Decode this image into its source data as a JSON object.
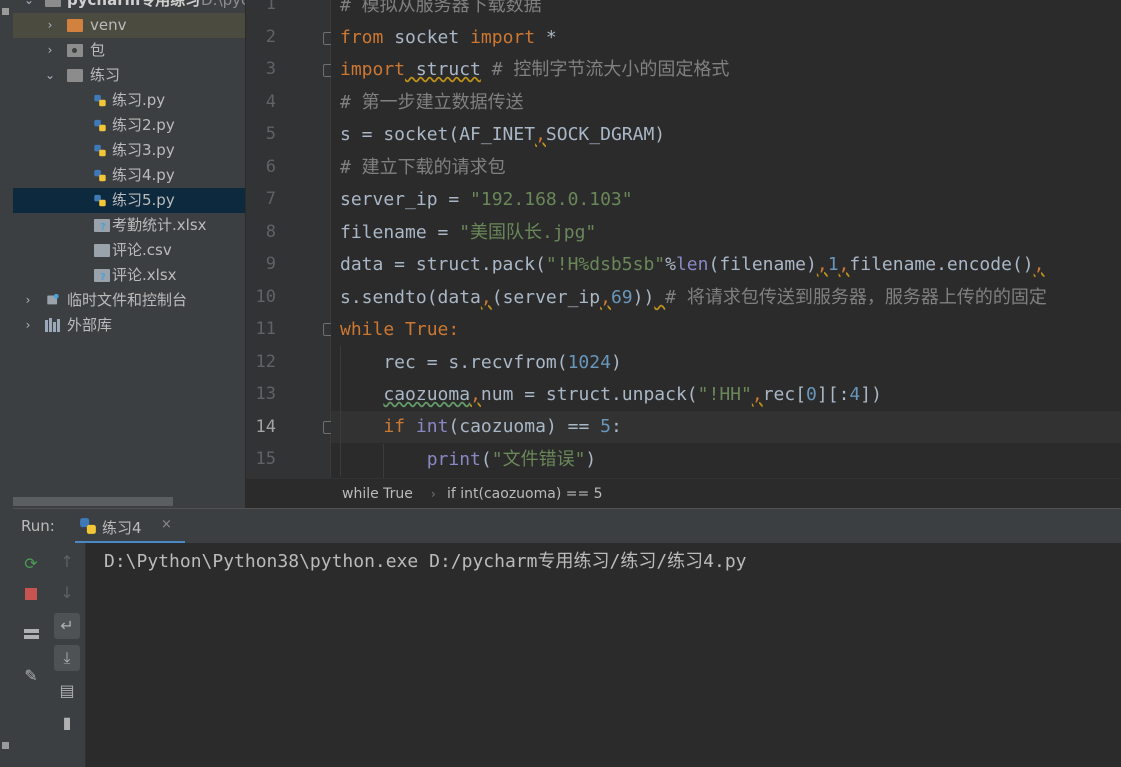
{
  "project": {
    "root_label": "pycharm专用练习",
    "root_path": "D:\\pyc",
    "items": [
      {
        "label": "venv"
      },
      {
        "label": "包"
      },
      {
        "label": "练习"
      },
      {
        "label": "练习.py"
      },
      {
        "label": "练习2.py"
      },
      {
        "label": "练习3.py"
      },
      {
        "label": "练习4.py"
      },
      {
        "label": "练习5.py"
      },
      {
        "label": "考勤统计.xlsx"
      },
      {
        "label": "评论.csv"
      },
      {
        "label": "评论.xlsx"
      },
      {
        "label": "临时文件和控制台"
      },
      {
        "label": "外部库"
      }
    ]
  },
  "editor": {
    "current_line": 14,
    "line_numbers": [
      "1",
      "2",
      "3",
      "4",
      "5",
      "6",
      "7",
      "8",
      "9",
      "10",
      "11",
      "12",
      "13",
      "14",
      "15"
    ],
    "lines": {
      "l1": "# 模拟从服务器下载数据",
      "l2_kw1": "from",
      "l2_mod": " socket ",
      "l2_kw2": "import",
      "l2_rest": " *",
      "l3_kw": "import",
      "l3_mod": " struct",
      "l3_cmt": " # 控制字节流大小的固定格式",
      "l4": "# 第一步建立数据传送",
      "l5_a": "s = socket(AF_INET",
      "l5_comma": ",",
      "l5_b": "SOCK_DGRAM)",
      "l6": "# 建立下载的请求包",
      "l7_a": "server_ip = ",
      "l7_str": "\"192.168.0.103\"",
      "l8_a": "filename = ",
      "l8_str": "\"美国队长.jpg\"",
      "l9_a": "data = struct.pack(",
      "l9_str": "\"!H%dsb5sb\"",
      "l9_op": "%",
      "l9_len": "len",
      "l9_b": "(filename)",
      "l9_c1": ",",
      "l9_num": "1",
      "l9_c2": ",",
      "l9_c": "filename.encode()",
      "l9_c3": ",",
      "l10_a": "s.sendto(data",
      "l10_c1": ",",
      "l10_b": "(server_ip",
      "l10_c2": ",",
      "l10_num": "69",
      "l10_c": "))",
      "l10_sp": " ",
      "l10_cmt": "# 将请求包传送到服务器，服务器上传的的固定",
      "l11_kw": "while",
      "l11_true": " True",
      "l11_colon": ":",
      "l12_a": "    rec = s.recvfrom(",
      "l12_num": "1024",
      "l12_b": ")",
      "l13_pre": "    ",
      "l13_var": "caozuoma",
      "l13_c1": ",",
      "l13_a": "num = struct.unpack(",
      "l13_str": "\"!HH\"",
      "l13_c2": ",",
      "l13_b": "rec[",
      "l13_num1": "0",
      "l13_c": "][:",
      "l13_num2": "4",
      "l13_d": "])",
      "l14_pre": "    ",
      "l14_kw": "if",
      "l14_sp": " ",
      "l14_int": "int",
      "l14_a": "(caozuoma) == ",
      "l14_num": "5",
      "l14_b": ":",
      "l15_pre": "        ",
      "l15_print": "print",
      "l15_a": "(",
      "l15_str": "\"文件错误\"",
      "l15_b": ")"
    }
  },
  "breadcrumb": {
    "items": [
      "while True",
      "if int(caozuoma) == 5"
    ],
    "separator": "›"
  },
  "run": {
    "title": "Run:",
    "tab_label": "练习4",
    "tab_close": "×",
    "console_output": "D:\\Python\\Python38\\python.exe D:/pycharm专用练习/练习/练习4.py"
  },
  "icons": {
    "rerun": "rerun-icon",
    "stop": "stop-icon",
    "layout": "layout-icon",
    "pin": "pin-icon",
    "up": "up-arrow-icon",
    "down": "down-arrow-icon",
    "soft_wrap": "soft-wrap-icon",
    "scroll_to_end": "scroll-to-end-icon",
    "print": "print-icon",
    "trash": "trash-icon"
  },
  "colors": {
    "keyword": "#cc7832",
    "string": "#6a8759",
    "number": "#6897bb",
    "comment": "#808080",
    "builtin": "#8888c6",
    "selection": "#0d293e",
    "rerun_green": "#499c54",
    "stop_red": "#c75450"
  }
}
